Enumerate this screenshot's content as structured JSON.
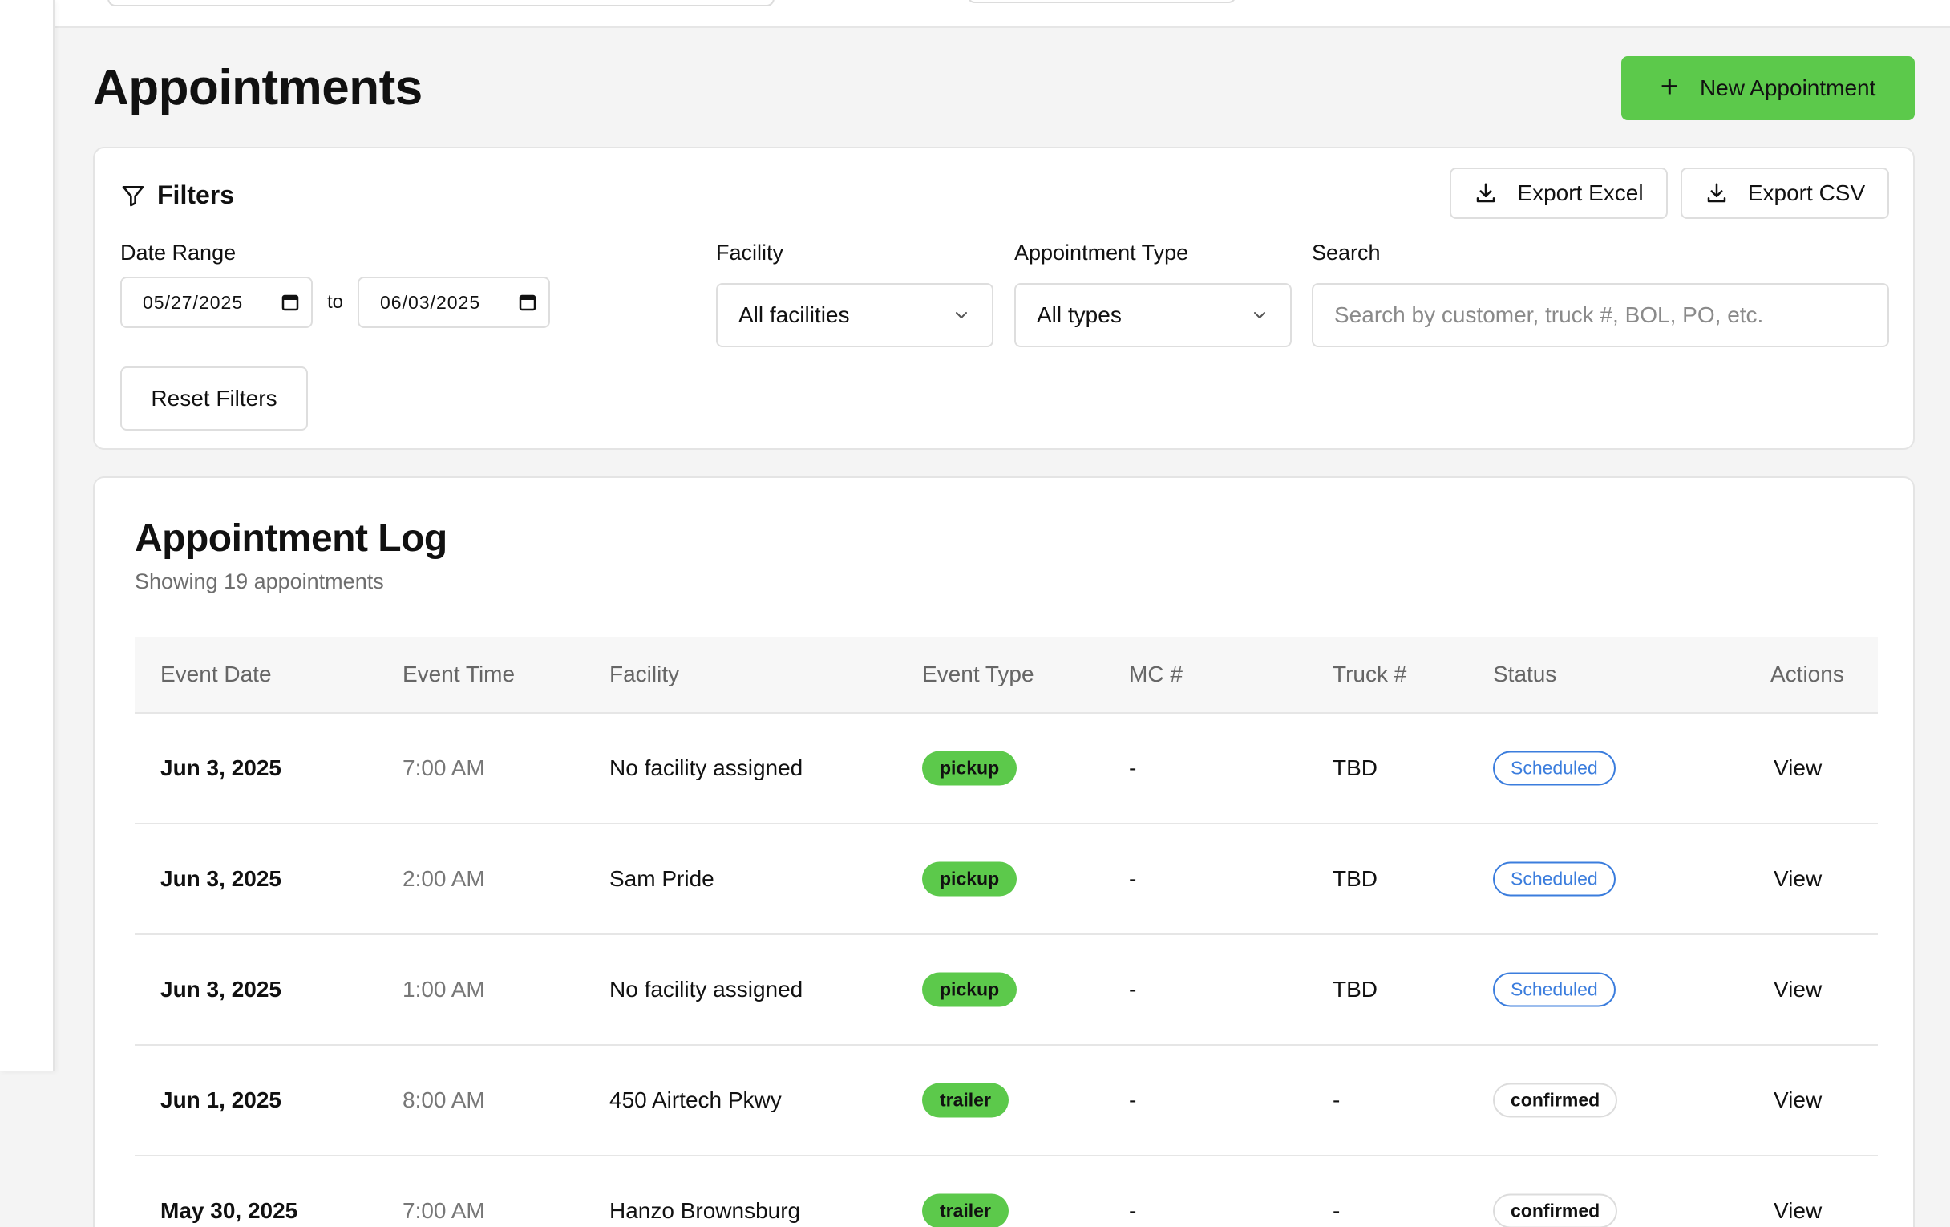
{
  "page": {
    "title": "Appointments"
  },
  "actions": {
    "new_appointment_label": "New Appointment"
  },
  "filters": {
    "heading": "Filters",
    "export_excel_label": "Export Excel",
    "export_csv_label": "Export CSV",
    "date_range_label": "Date Range",
    "date_from": "05/27/2025",
    "to_label": "to",
    "date_to": "06/03/2025",
    "facility_label": "Facility",
    "facility_value": "All facilities",
    "type_label": "Appointment Type",
    "type_value": "All types",
    "search_label": "Search",
    "search_placeholder": "Search by customer, truck #, BOL, PO, etc.",
    "reset_label": "Reset Filters"
  },
  "log": {
    "title": "Appointment Log",
    "subtitle": "Showing 19 appointments",
    "columns": [
      "Event Date",
      "Event Time",
      "Facility",
      "Event Type",
      "MC #",
      "Truck #",
      "Status",
      "Actions"
    ],
    "rows": [
      {
        "date": "Jun 3, 2025",
        "time": "7:00 AM",
        "facility": "No facility assigned",
        "type": "pickup",
        "mc": "-",
        "truck": "TBD",
        "status": "Scheduled",
        "action": "View"
      },
      {
        "date": "Jun 3, 2025",
        "time": "2:00 AM",
        "facility": "Sam Pride",
        "type": "pickup",
        "mc": "-",
        "truck": "TBD",
        "status": "Scheduled",
        "action": "View"
      },
      {
        "date": "Jun 3, 2025",
        "time": "1:00 AM",
        "facility": "No facility assigned",
        "type": "pickup",
        "mc": "-",
        "truck": "TBD",
        "status": "Scheduled",
        "action": "View"
      },
      {
        "date": "Jun 1, 2025",
        "time": "8:00 AM",
        "facility": "450 Airtech Pkwy",
        "type": "trailer",
        "mc": "-",
        "truck": "-",
        "status": "confirmed",
        "action": "View"
      },
      {
        "date": "May 30, 2025",
        "time": "7:00 AM",
        "facility": "Hanzo Brownsburg",
        "type": "trailer",
        "mc": "-",
        "truck": "-",
        "status": "confirmed",
        "action": "View"
      }
    ]
  },
  "colors": {
    "accent_green": "#5cc94b",
    "scheduled_blue": "#3b7ddd"
  }
}
